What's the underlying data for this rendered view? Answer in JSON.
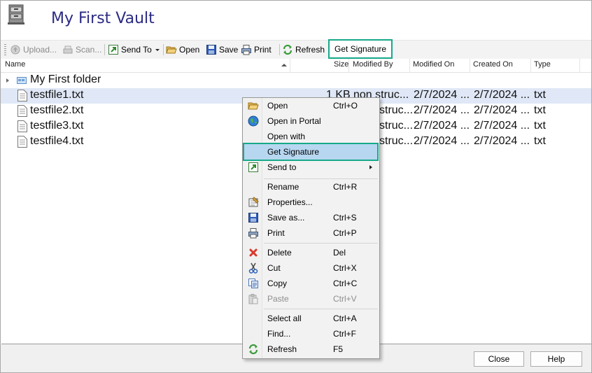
{
  "window": {
    "title": "My First Vault"
  },
  "toolbar": {
    "upload": "Upload...",
    "scan": "Scan...",
    "send_to": "Send To",
    "open": "Open",
    "save": "Save",
    "print": "Print",
    "refresh": "Refresh",
    "get_signature": "Get Signature"
  },
  "columns": [
    "Name",
    "Size",
    "Modified By",
    "Modified On",
    "Created On",
    "Type"
  ],
  "rows": [
    {
      "name": "My First folder",
      "size": "",
      "modified_by": "",
      "modified_on": "",
      "created_on": "",
      "type": "",
      "kind": "folder"
    },
    {
      "name": "testfile1.txt",
      "size": "1 KB",
      "modified_by": "non struc...",
      "modified_on": "2/7/2024 ...",
      "created_on": "2/7/2024 ...",
      "type": "txt",
      "kind": "file",
      "selected": true
    },
    {
      "name": "testfile2.txt",
      "size": "",
      "modified_by": "struc...",
      "modified_on": "2/7/2024 ...",
      "created_on": "2/7/2024 ...",
      "type": "txt",
      "kind": "file"
    },
    {
      "name": "testfile3.txt",
      "size": "",
      "modified_by": "struc...",
      "modified_on": "2/7/2024 ...",
      "created_on": "2/7/2024 ...",
      "type": "txt",
      "kind": "file"
    },
    {
      "name": "testfile4.txt",
      "size": "",
      "modified_by": "struc...",
      "modified_on": "2/7/2024 ...",
      "created_on": "2/7/2024 ...",
      "type": "txt",
      "kind": "file"
    }
  ],
  "context_menu": {
    "items": [
      {
        "label": "Open",
        "shortcut": "Ctrl+O",
        "icon": "open-folder-icon"
      },
      {
        "label": "Open in Portal",
        "shortcut": "",
        "icon": "globe-icon"
      },
      {
        "label": "Open with",
        "shortcut": "",
        "icon": ""
      },
      {
        "label": "Get Signature",
        "shortcut": "",
        "icon": "",
        "highlighted": true
      },
      {
        "label": "Send to",
        "shortcut": "",
        "icon": "send-to-icon",
        "submenu": true
      },
      {
        "label": "Rename",
        "shortcut": "Ctrl+R",
        "icon": ""
      },
      {
        "label": "Properties...",
        "shortcut": "",
        "icon": "properties-icon"
      },
      {
        "label": "Save as...",
        "shortcut": "Ctrl+S",
        "icon": "save-icon"
      },
      {
        "label": "Print",
        "shortcut": "Ctrl+P",
        "icon": "printer-icon"
      },
      {
        "label": "Delete",
        "shortcut": "Del",
        "icon": "delete-icon"
      },
      {
        "label": "Cut",
        "shortcut": "Ctrl+X",
        "icon": "cut-icon"
      },
      {
        "label": "Copy",
        "shortcut": "Ctrl+C",
        "icon": "copy-icon"
      },
      {
        "label": "Paste",
        "shortcut": "Ctrl+V",
        "icon": "paste-icon",
        "disabled": true
      },
      {
        "label": "Select all",
        "shortcut": "Ctrl+A",
        "icon": ""
      },
      {
        "label": "Find...",
        "shortcut": "Ctrl+F",
        "icon": ""
      },
      {
        "label": "Refresh",
        "shortcut": "F5",
        "icon": "refresh-icon"
      }
    ]
  },
  "footer": {
    "close": "Close",
    "help": "Help"
  },
  "colors": {
    "title": "#2b2b84",
    "highlight_border": "#16a98a",
    "menu_highlight": "#b7d7f1",
    "row_selected": "#e0e8f7"
  }
}
